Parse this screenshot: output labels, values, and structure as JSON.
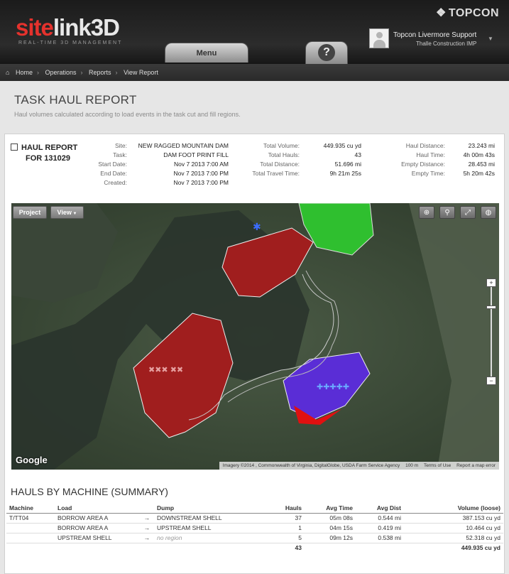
{
  "header": {
    "logo_a": "site",
    "logo_b": "link3D",
    "tagline": "REAL-TIME 3D MANAGEMENT",
    "brand": "TOPCON",
    "user_name": "Topcon Livermore Support",
    "user_company": "Thalle Construction  IMP",
    "menu_label": "Menu",
    "help_label": "?"
  },
  "breadcrumb": {
    "home": "Home",
    "operations": "Operations",
    "reports": "Reports",
    "view_report": "View Report"
  },
  "page": {
    "title": "TASK HAUL REPORT",
    "subtitle": "Haul volumes calculated according to load events in the task cut and fill regions."
  },
  "report": {
    "title_line1": "HAUL REPORT",
    "title_line2": "FOR 131029",
    "col1": [
      {
        "key": "Site:",
        "value": "NEW RAGGED MOUNTAIN DAM"
      },
      {
        "key": "Task:",
        "value": "DAM FOOT PRINT FILL"
      },
      {
        "key": "Start Date:",
        "value": "Nov 7 2013 7:00 AM"
      },
      {
        "key": "End Date:",
        "value": "Nov 7 2013 7:00 PM"
      },
      {
        "key": "Created:",
        "value": "Nov 7 2013 7:00 PM"
      }
    ],
    "col2": [
      {
        "key": "Total Volume:",
        "value": "449.935 cu yd"
      },
      {
        "key": "Total Hauls:",
        "value": "43"
      },
      {
        "key": "Total Distance:",
        "value": "51.696 mi"
      },
      {
        "key": "Total Travel Time:",
        "value": "9h 21m 25s"
      }
    ],
    "col3": [
      {
        "key": "Haul Distance:",
        "value": "23.243 mi"
      },
      {
        "key": "Haul Time:",
        "value": "4h 00m 43s"
      },
      {
        "key": "Empty Distance:",
        "value": "28.453 mi"
      },
      {
        "key": "Empty Time:",
        "value": "5h 20m 42s"
      }
    ]
  },
  "map": {
    "project_btn": "Project",
    "view_btn": "View",
    "zoom_in": "+",
    "zoom_out": "−",
    "google": "Google",
    "attribution": "Imagery ©2014 , Commonwealth of Virginia, DigitalGlobe, USDA Farm Service Agency",
    "scale": "100 m",
    "terms": "Terms of Use",
    "report_error": "Report a map error",
    "icons": [
      "zoom-extents-icon",
      "search-icon",
      "fullscreen-icon",
      "globe-icon"
    ],
    "colors": {
      "cut_region": "#a01e1e",
      "fill_region": "#5a2dd6",
      "green_region": "#2fbf2f"
    }
  },
  "hauls": {
    "title": "HAULS BY MACHINE (SUMMARY)",
    "columns": [
      "Machine",
      "Load",
      "",
      "Dump",
      "Hauls",
      "Avg Time",
      "Avg Dist",
      "Volume (loose)"
    ],
    "rows": [
      {
        "machine": "T/TT04",
        "load": "BORROW AREA A",
        "arrow": "→",
        "dump": "DOWNSTREAM SHELL",
        "hauls": "37",
        "avg_time": "05m 08s",
        "avg_dist": "0.544 mi",
        "volume": "387.153 cu yd"
      },
      {
        "machine": "",
        "load": "BORROW AREA A",
        "arrow": "→",
        "dump": "UPSTREAM SHELL",
        "hauls": "1",
        "avg_time": "04m 15s",
        "avg_dist": "0.419 mi",
        "volume": "10.464 cu yd"
      },
      {
        "machine": "",
        "load": "UPSTREAM SHELL",
        "arrow": "→",
        "dump": "no region",
        "hauls": "5",
        "avg_time": "09m 12s",
        "avg_dist": "0.538 mi",
        "volume": "52.318 cu yd"
      }
    ],
    "total_hauls": "43",
    "total_volume": "449.935 cu yd"
  }
}
